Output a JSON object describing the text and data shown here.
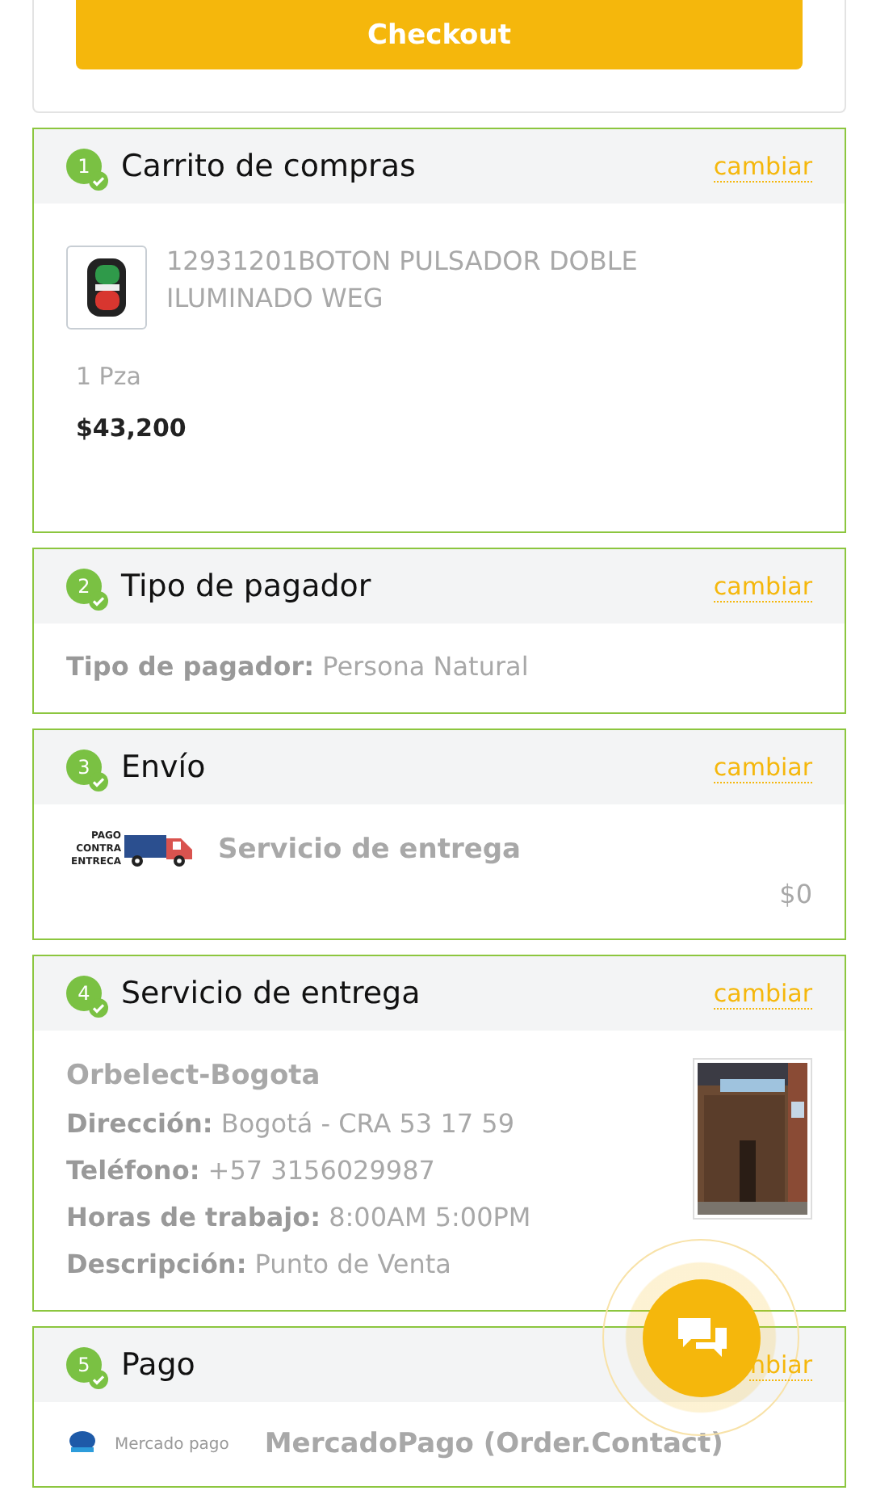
{
  "checkout_button": "Checkout",
  "steps": [
    {
      "number": "1",
      "title": "Carrito de compras",
      "action": "cambiar",
      "kind": "cart",
      "completed": true,
      "product": {
        "name": "12931201BOTON PULSADOR DOBLE ILUMINADO WEG",
        "quantity": "1 Pza",
        "price": "$43,200"
      }
    },
    {
      "number": "2",
      "title": "Tipo de pagador",
      "action": "cambiar",
      "kind": "fields",
      "completed": true,
      "fields": [
        {
          "label": "Tipo de pagador:",
          "value": "Persona Natural"
        }
      ]
    },
    {
      "number": "3",
      "title": "Envío",
      "action": "cambiar",
      "kind": "shipping",
      "completed": true,
      "logo_text": "PAGO CONTRA ENTRECA",
      "service": "Servicio de entrega",
      "cost": "$0"
    },
    {
      "number": "4",
      "title": "Servicio de entrega",
      "action": "cambiar",
      "kind": "store",
      "completed": true,
      "store_name": "Orbelect-Bogota",
      "fields": [
        {
          "label": "Dirección:",
          "value": "Bogotá - CRA 53 17 59"
        },
        {
          "label": "Teléfono:",
          "value": "+57 3156029987"
        },
        {
          "label": "Horas de trabajo:",
          "value": "8:00AM 5:00PM"
        },
        {
          "label": "Descripción:",
          "value": "Punto de Venta"
        }
      ]
    },
    {
      "number": "5",
      "title": "Pago",
      "action": "nbiar",
      "kind": "payment",
      "completed": true,
      "logo_text": "Mercado pago",
      "method": "MercadoPago (Order.Contact)"
    }
  ]
}
